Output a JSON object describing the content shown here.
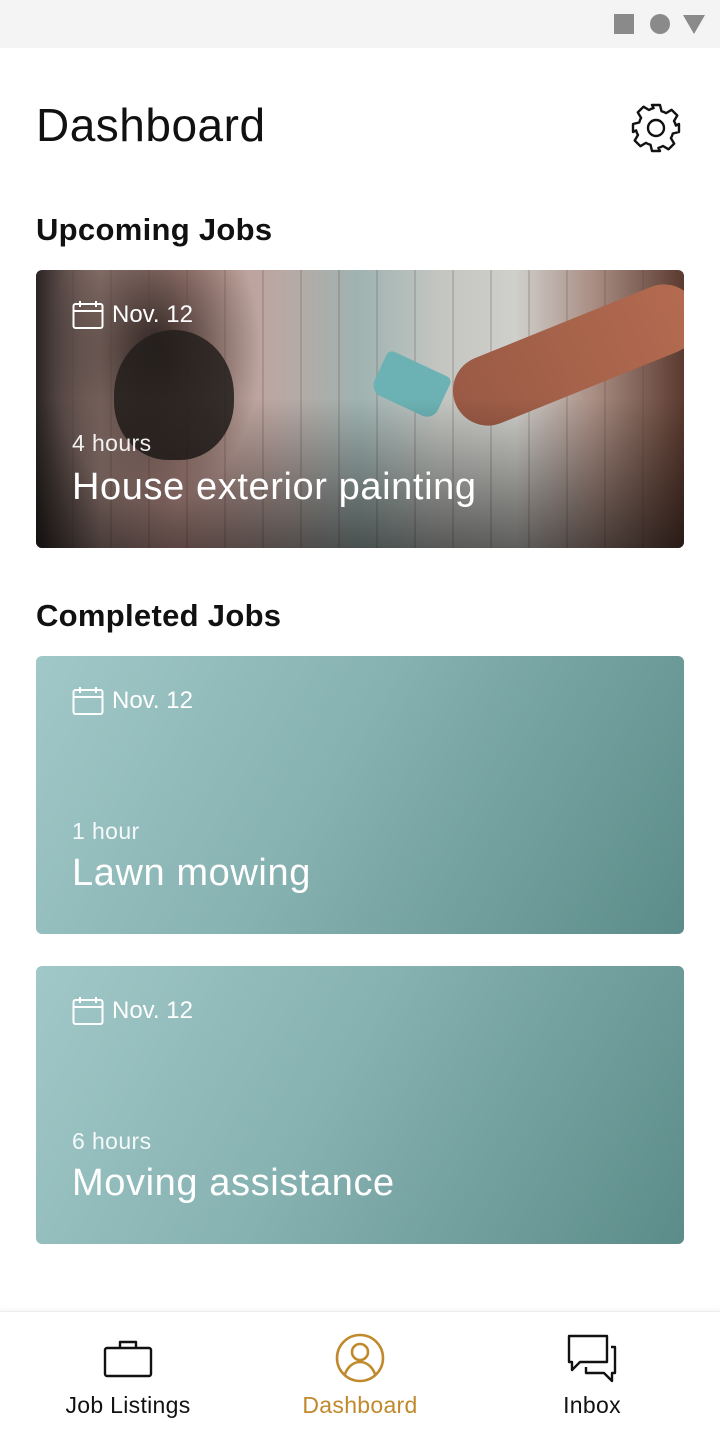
{
  "header": {
    "title": "Dashboard",
    "settings_icon": "gear-icon"
  },
  "upcoming": {
    "section_title": "Upcoming Jobs",
    "jobs": [
      {
        "date": "Nov. 12",
        "duration": "4 hours",
        "title": "House exterior painting"
      }
    ]
  },
  "completed": {
    "section_title": "Completed Jobs",
    "jobs": [
      {
        "date": "Nov. 12",
        "duration": "1 hour",
        "title": "Lawn mowing"
      },
      {
        "date": "Nov. 12",
        "duration": "6 hours",
        "title": "Moving assistance"
      }
    ]
  },
  "bottom_nav": {
    "items": [
      {
        "label": "Job Listings",
        "icon": "briefcase-icon",
        "active": false
      },
      {
        "label": "Dashboard",
        "icon": "user-circle-icon",
        "active": true
      },
      {
        "label": "Inbox",
        "icon": "chat-bubbles-icon",
        "active": false
      }
    ]
  },
  "colors": {
    "accent": "#c0892c",
    "card_teal_light": "#a1c8c8",
    "card_teal_dark": "#5c8c89"
  }
}
